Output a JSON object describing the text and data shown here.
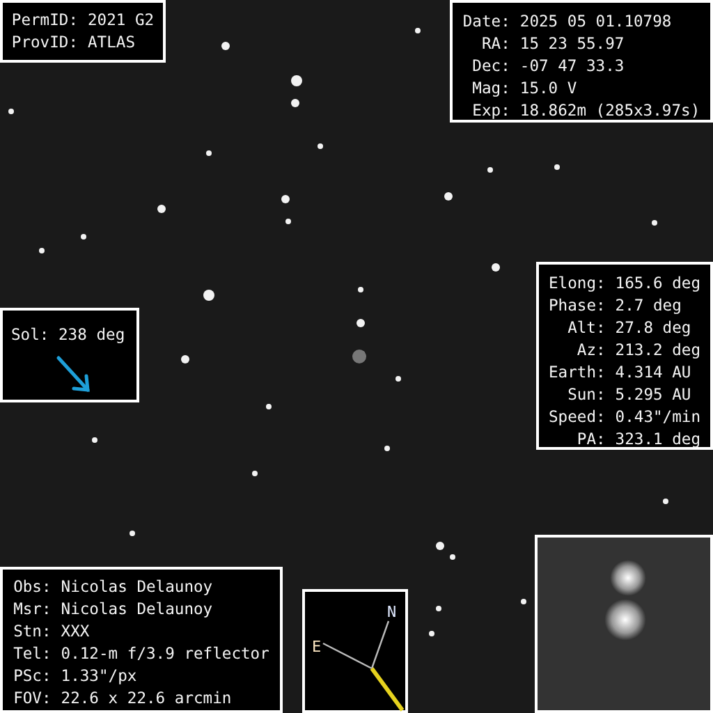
{
  "object_panel": {
    "lines": [
      {
        "label": "PermID:",
        "value": "2021 G2"
      },
      {
        "label": "ProvID:",
        "value": "ATLAS"
      }
    ]
  },
  "observation_panel": {
    "lines": [
      {
        "label": "Date:",
        "value": "2025 05 01.10798"
      },
      {
        "label": "RA:",
        "value": "15 23 55.97"
      },
      {
        "label": "Dec:",
        "value": "-07 47 33.3"
      },
      {
        "label": "Mag:",
        "value": "15.0 V"
      },
      {
        "label": "Exp:",
        "value": "18.862m (285x3.97s)"
      }
    ]
  },
  "sol_panel": {
    "text": "Sol: 238 deg"
  },
  "geometry_panel": {
    "lines": [
      {
        "label": "Elong:",
        "value": "165.6 deg"
      },
      {
        "label": "Phase:",
        "value": "2.7 deg"
      },
      {
        "label": "Alt:",
        "value": "27.8 deg"
      },
      {
        "label": "Az:",
        "value": "213.2 deg"
      },
      {
        "label": "Earth:",
        "value": "4.314 AU"
      },
      {
        "label": "Sun:",
        "value": "5.295 AU"
      },
      {
        "label": "Speed:",
        "value": "0.43\"/min"
      },
      {
        "label": "PA:",
        "value": "323.1 deg"
      }
    ]
  },
  "observer_panel": {
    "lines": [
      {
        "label": "Obs:",
        "value": "Nicolas Delaunoy"
      },
      {
        "label": "Msr:",
        "value": "Nicolas Delaunoy"
      },
      {
        "label": "Stn:",
        "value": "XXX"
      },
      {
        "label": "Tel:",
        "value": "0.12-m f/3.9 reflector"
      },
      {
        "label": "PSc:",
        "value": "1.33\"/px"
      },
      {
        "label": "FOV:",
        "value": "22.6 x 22.6 arcmin"
      }
    ]
  },
  "compass": {
    "north": "N",
    "east": "E"
  }
}
